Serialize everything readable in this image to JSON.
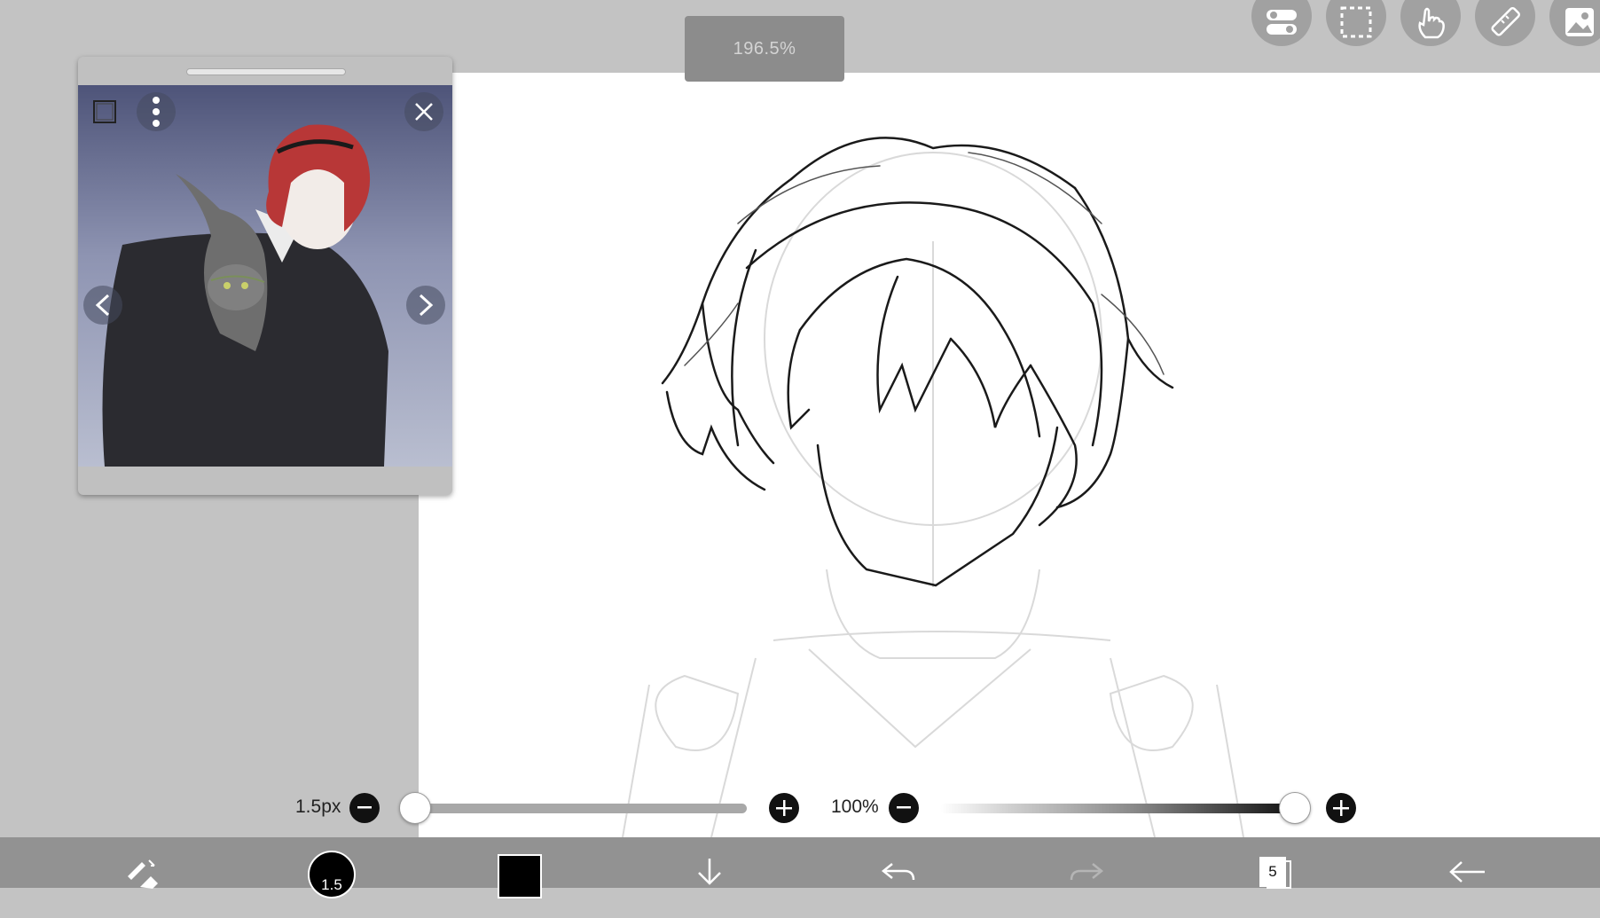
{
  "zoom": {
    "label": "196.5%"
  },
  "top_toolbar": {
    "icons": [
      "toggle-settings-icon",
      "selection-icon",
      "hand-touch-icon",
      "ruler-icon",
      "image-icon"
    ]
  },
  "reference_panel": {
    "icons": [
      "frame-icon",
      "more-vertical-icon",
      "close-icon",
      "chevron-left-icon",
      "chevron-right-icon"
    ],
    "image_description_icon": "reference-photo"
  },
  "brush": {
    "size_label": "1.5px",
    "size_value": 1.5,
    "size_fraction": 0.03,
    "opacity_label": "100%",
    "opacity_fraction": 1.0
  },
  "bottom_bar": {
    "brush_indicator_label": "1.5",
    "color_swatch": "#000000",
    "layers_count": "5",
    "icons": [
      "pen-eraser-swap-icon",
      "brush-size-icon",
      "color-swatch",
      "download-icon",
      "undo-icon",
      "redo-icon",
      "layers-icon",
      "back-icon"
    ]
  },
  "colors": {
    "background": "#c3c3c3",
    "canvas": "#ffffff",
    "bar": "#929292",
    "accent_dark": "#111111"
  }
}
